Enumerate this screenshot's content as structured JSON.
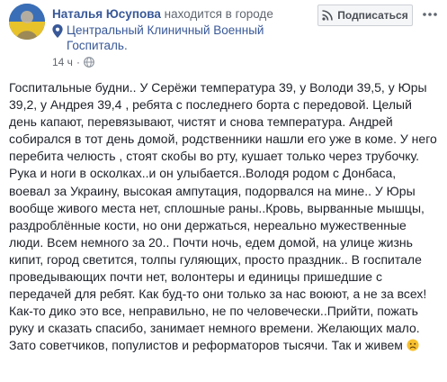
{
  "post": {
    "author": "Наталья Юсупова",
    "status": "находится в городе",
    "place": "Центральный Клиничный Военный Госпиталь.",
    "time": "14 ч",
    "privacy_icon": "globe-icon",
    "follow_label": "Подписаться",
    "text": "Госпитальные будни.. У Серёжи температура 39, у Володи 39,5, у Юры 39,2, у Андрея 39,4 , ребята с последнего борта с передовой. Целый день капают, перевязывают, чистят и снова температура. Андрей собирался в тот день домой, родственники нашли его уже в коме. У него перебита челюсть , стоят скобы во рту, кушает только через трубочку. Рука и ноги в осколках..и он улыбается..Володя родом с Донбаса, воевал за Украину, высокая ампутация, подорвался на мине.. У Юры вообще живого места нет, сплошные раны..Кровь, вырванные мышцы, раздроблённые кости, но они держаться, нереально мужественные люди. Всем немного за 20.. Почти ночь, едем домой, на улице жизнь кипит, город светится, толпы гуляющих, просто праздник.. В госпитале проведывающих почти нет, волонтеры и единицы пришедшие с передачей для ребят. Как буд-то они только за нас воюют, а не за всех! Как-то дико это все, неправильно, не по человечески..Прийти, пожать руку и сказать спасибо, занимает немного времени. Желающих мало. Зато советчиков, популистов и реформаторов тысячи. Так и живем",
    "end_emoji": "sad-face-emoji"
  },
  "colors": {
    "link": "#385898",
    "text": "#1d2129",
    "meta": "#616770"
  }
}
